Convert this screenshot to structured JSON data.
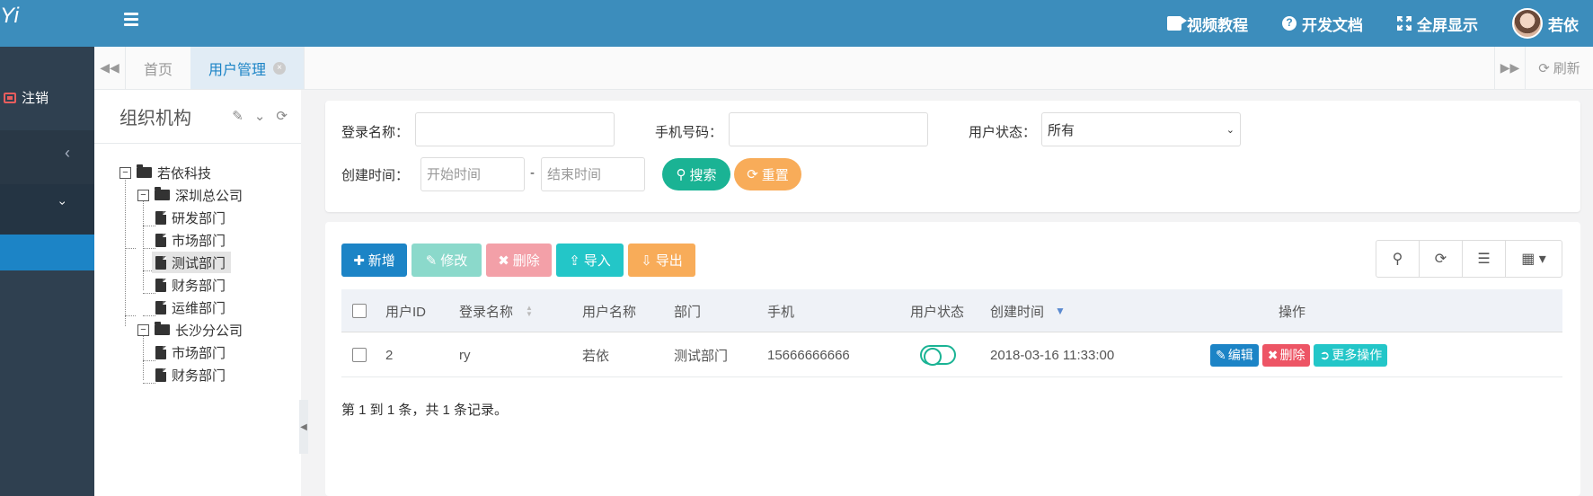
{
  "sidebar": {
    "brand": "Yi",
    "logout_label": "注销",
    "collapse_icon": "chevron-left",
    "expand_icon": "chevron-down"
  },
  "header": {
    "nav": [
      {
        "label": "视频教程",
        "icon": "video-icon"
      },
      {
        "label": "开发文档",
        "icon": "question-circle-icon"
      },
      {
        "label": "全屏显示",
        "icon": "fullscreen-icon"
      },
      {
        "label": "若依",
        "icon": "avatar"
      }
    ]
  },
  "tabs": {
    "home_label": "首页",
    "current_label": "用户管理",
    "refresh_label": "刷新"
  },
  "org": {
    "title": "组织机构",
    "tree": {
      "root": "若依科技",
      "branch1": "深圳总公司",
      "b1_children": [
        "研发部门",
        "市场部门",
        "测试部门",
        "财务部门",
        "运维部门"
      ],
      "branch2": "长沙分公司",
      "b2_children": [
        "市场部门",
        "财务部门"
      ],
      "selected": "测试部门"
    }
  },
  "search": {
    "login_label": "登录名称：",
    "phone_label": "手机号码：",
    "status_label": "用户状态：",
    "status_value": "所有",
    "time_label": "创建时间：",
    "start_placeholder": "开始时间",
    "end_placeholder": "结束时间",
    "dash": "-",
    "search_btn": "搜索",
    "reset_btn": "重置"
  },
  "toolbar": {
    "add": "新增",
    "edit": "修改",
    "delete": "删除",
    "import": "导入",
    "export": "导出"
  },
  "table": {
    "headers": [
      "用户ID",
      "登录名称",
      "用户名称",
      "部门",
      "手机",
      "用户状态",
      "创建时间",
      "操作"
    ],
    "rows": [
      {
        "id": "2",
        "login": "ry",
        "name": "若依",
        "dept": "测试部门",
        "phone": "15666666666",
        "status_on": false,
        "created": "2018-03-16 11:33:00",
        "actions": [
          "编辑",
          "删除",
          "更多操作"
        ]
      }
    ],
    "pagination": "第 1 到 1 条，共 1 条记录。"
  },
  "colors": {
    "header_blue": "#3c8dbc",
    "sidebar_dark": "#2f4050",
    "active_blue": "#1c84c6",
    "green": "#1ab394",
    "orange": "#f8ac59",
    "red": "#ed5565",
    "cyan": "#23c6c8"
  }
}
